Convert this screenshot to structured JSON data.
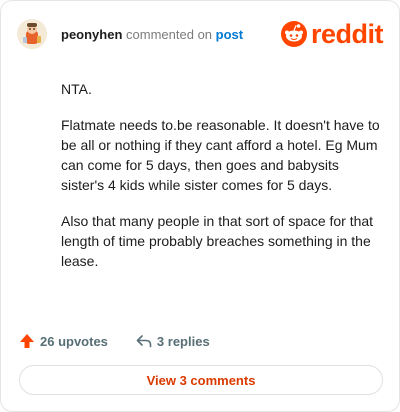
{
  "header": {
    "username": "peonyhen",
    "commented_text": "commented on",
    "post_link": "post",
    "brand_wordmark": "reddit",
    "brand_color": "#ff4500"
  },
  "comment": {
    "paragraphs": [
      "NTA.",
      "Flatmate needs to.be reasonable. It doesn't have to be all or nothing if they cant afford a hotel. Eg Mum can come for 5 days, then goes and babysits sister's 4 kids while sister comes for 5 days.",
      "Also that many people in that sort of space for that length of time probably breaches something in the lease."
    ]
  },
  "actions": {
    "upvotes_label": "26 upvotes",
    "replies_label": "3 replies",
    "upvote_icon": "upvote-arrow-icon",
    "reply_icon": "reply-arrow-icon"
  },
  "footer": {
    "view_comments_label": "View 3 comments"
  }
}
